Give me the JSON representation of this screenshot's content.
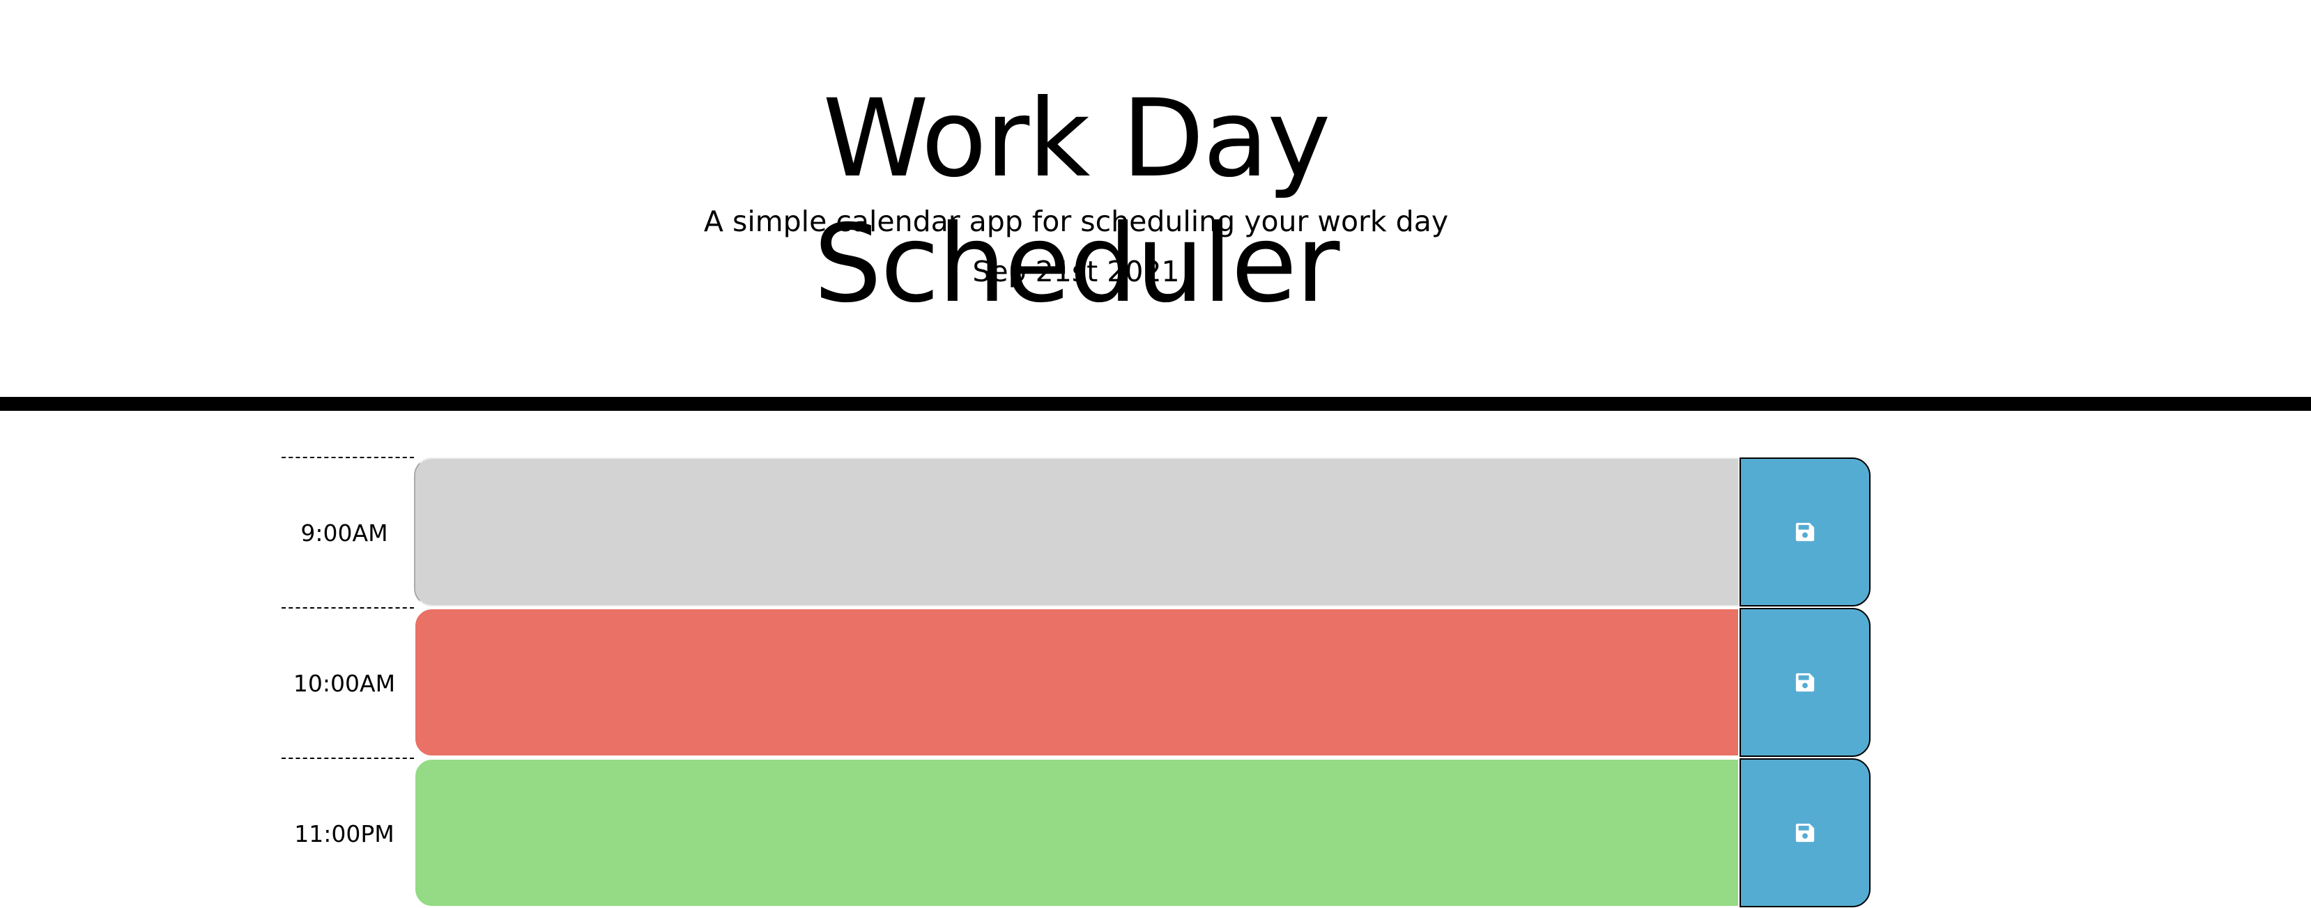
{
  "header": {
    "title": "Work Day Scheduler",
    "subtitle": "A simple calendar app for scheduling your work day",
    "current_date": "Sep 21st 2021"
  },
  "time_blocks": [
    {
      "hour": "9:00AM",
      "state": "past",
      "color": "#d3d3d3",
      "text": "",
      "save_icon": "save-icon"
    },
    {
      "hour": "10:00AM",
      "state": "present",
      "color": "#ea7166",
      "text": "",
      "save_icon": "save-icon"
    },
    {
      "hour": "11:00PM",
      "state": "future",
      "color": "#95da84",
      "text": "",
      "save_icon": "save-icon"
    }
  ],
  "colors": {
    "save_button": "#55acd2",
    "divider": "#000000"
  }
}
